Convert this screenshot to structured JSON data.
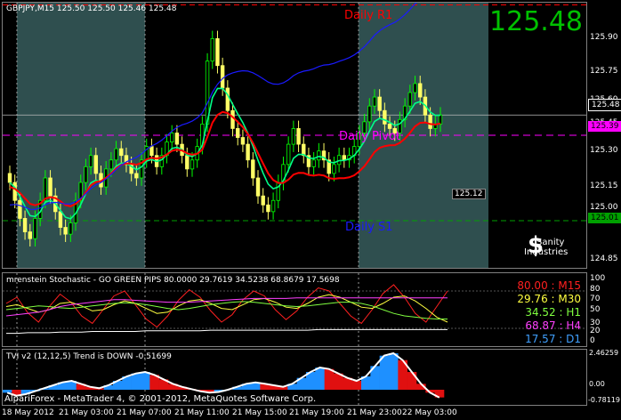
{
  "colors": {
    "background": "#000000",
    "session_shade": "#2f4f4f",
    "bull_candle": "#00ff00",
    "bear_candle": "#ffff66",
    "ma_red": "#ff0000",
    "ma_green": "#00ff88",
    "ma_blue": "#1a1aff",
    "pivot": "#ff00ff",
    "r1": "#ff0000",
    "s1": "#00a000",
    "big_price": "#00c000"
  },
  "main": {
    "header": "GBPJPY,M15  125.50 125.50 125.46 125.48",
    "big_price": "125.48",
    "label_r1": "Daily R1",
    "label_pivot": "Daily Pivot",
    "label_s1": "Daily S1",
    "price_box": "125.12",
    "logo_top": "Sanity",
    "logo_bottom": "Industries",
    "y_ticks": [
      "125.90",
      "125.75",
      "125.60",
      "125.45",
      "125.30",
      "125.15",
      "125.00",
      "124.85"
    ],
    "price_labels": {
      "current": "125.48",
      "pivot": "125.39",
      "s1": "125.01"
    }
  },
  "stoch": {
    "header": "mrenstein Stochastic - GO GREEN PIPS 80.0000 29.7619 34.5238 68.8679 17.5698",
    "y_ticks": [
      "100",
      "80",
      "70",
      "50",
      "30",
      "20",
      "0"
    ],
    "rows": [
      {
        "text": "80.00 : M15",
        "color": "#ff2020"
      },
      {
        "text": "29.76 : M30",
        "color": "#ffff40"
      },
      {
        "text": "34.52 : H1",
        "color": "#80ff40"
      },
      {
        "text": "68.87 : H4",
        "color": "#ff40ff"
      },
      {
        "text": "17.57 : D1",
        "color": "#40a0ff"
      }
    ]
  },
  "tvi": {
    "header": "TVI v2 (12,12,5) Trend is DOWN -0.51699",
    "y_ticks": [
      "2.46259",
      "0.00",
      "-0.78119"
    ],
    "watermark": "AlpariForex - MetaTrader 4, © 2001-2012, MetaQuotes Software Corp."
  },
  "x_axis": [
    "18 May 2012",
    "21 May 03:00",
    "21 May 07:00",
    "21 May 11:00",
    "21 May 15:00",
    "21 May 19:00",
    "21 May 23:00",
    "22 May 03:00"
  ],
  "chart_data": [
    {
      "type": "candlestick",
      "title": "GBPJPY,M15",
      "ylim": [
        124.8,
        125.98
      ],
      "y_ticks": [
        125.9,
        125.75,
        125.6,
        125.45,
        125.3,
        125.15,
        125.0,
        124.85
      ],
      "last": 125.48,
      "levels": {
        "daily_r1": 125.97,
        "daily_pivot": 125.39,
        "daily_s1": 125.01
      },
      "closes": [
        125.18,
        125.1,
        125.02,
        124.96,
        124.93,
        125.02,
        125.1,
        125.2,
        125.12,
        125.05,
        124.98,
        124.95,
        125.0,
        125.1,
        125.18,
        125.25,
        125.3,
        125.22,
        125.16,
        125.24,
        125.28,
        125.33,
        125.3,
        125.26,
        125.22,
        125.2,
        125.28,
        125.34,
        125.3,
        125.25,
        125.3,
        125.36,
        125.4,
        125.35,
        125.3,
        125.24,
        125.28,
        125.34,
        125.44,
        125.72,
        125.82,
        125.7,
        125.6,
        125.5,
        125.42,
        125.38,
        125.35,
        125.28,
        125.2,
        125.12,
        125.08,
        125.05,
        125.1,
        125.18,
        125.26,
        125.35,
        125.42,
        125.35,
        125.3,
        125.25,
        125.28,
        125.32,
        125.28,
        125.22,
        125.26,
        125.3,
        125.28,
        125.3,
        125.34,
        125.4,
        125.45,
        125.52,
        125.56,
        125.5,
        125.44,
        125.42,
        125.4,
        125.46,
        125.52,
        125.58,
        125.62,
        125.56,
        125.48,
        125.42,
        125.44,
        125.48
      ]
    },
    {
      "type": "line",
      "title": "mrenstein Stochastic",
      "ylim": [
        0,
        100
      ],
      "series": [
        {
          "name": "M15",
          "values": [
            60,
            70,
            45,
            30,
            55,
            75,
            62,
            40,
            28,
            50,
            72,
            80,
            58,
            35,
            22,
            40,
            65,
            82,
            70,
            48,
            30,
            42,
            66,
            80,
            72,
            50,
            34,
            48,
            70,
            85,
            80,
            60,
            40,
            28,
            50,
            76,
            90,
            70,
            44,
            30,
            55,
            80
          ]
        },
        {
          "name": "M30",
          "values": [
            55,
            58,
            52,
            46,
            50,
            60,
            62,
            56,
            48,
            50,
            58,
            64,
            60,
            52,
            44,
            46,
            56,
            64,
            66,
            60,
            52,
            50,
            58,
            66,
            68,
            62,
            54,
            52,
            60,
            70,
            74,
            70,
            62,
            54,
            52,
            60,
            70,
            72,
            64,
            52,
            38,
            30
          ]
        },
        {
          "name": "H1",
          "values": [
            50,
            52,
            54,
            56,
            55,
            53,
            52,
            54,
            56,
            58,
            60,
            61,
            60,
            58,
            55,
            52,
            50,
            52,
            55,
            58,
            60,
            62,
            63,
            62,
            60,
            58,
            56,
            55,
            56,
            58,
            60,
            62,
            62,
            60,
            56,
            50,
            44,
            40,
            38,
            36,
            35,
            35
          ]
        },
        {
          "name": "H4",
          "values": [
            40,
            42,
            44,
            46,
            50,
            55,
            58,
            60,
            62,
            64,
            66,
            66,
            65,
            64,
            63,
            62,
            62,
            62,
            63,
            64,
            65,
            66,
            67,
            68,
            68,
            68,
            68,
            69,
            69,
            69,
            69,
            69,
            69,
            69,
            69,
            69,
            69,
            69,
            69,
            69,
            69,
            69
          ]
        },
        {
          "name": "D1",
          "values": [
            12,
            12,
            13,
            13,
            13,
            14,
            14,
            14,
            15,
            15,
            15,
            15,
            15,
            16,
            16,
            16,
            16,
            16,
            16,
            17,
            17,
            17,
            17,
            17,
            17,
            17,
            17,
            17,
            17,
            18,
            18,
            18,
            18,
            18,
            18,
            18,
            18,
            18,
            18,
            18,
            18,
            18
          ]
        }
      ]
    },
    {
      "type": "area",
      "title": "TVI v2 (12,12,5)",
      "ylim": [
        -0.78119,
        2.46259
      ],
      "values": [
        -0.2,
        -0.4,
        -0.3,
        -0.1,
        0.1,
        0.3,
        0.5,
        0.6,
        0.4,
        0.2,
        0.1,
        0.3,
        0.6,
        0.9,
        1.1,
        1.2,
        1.0,
        0.7,
        0.4,
        0.2,
        0.05,
        -0.1,
        -0.2,
        -0.15,
        0.0,
        0.2,
        0.4,
        0.5,
        0.4,
        0.3,
        0.2,
        0.4,
        0.8,
        1.2,
        1.5,
        1.4,
        1.1,
        0.8,
        0.6,
        0.9,
        1.6,
        2.3,
        2.46,
        2.0,
        1.2,
        0.4,
        -0.2,
        -0.52
      ]
    }
  ]
}
